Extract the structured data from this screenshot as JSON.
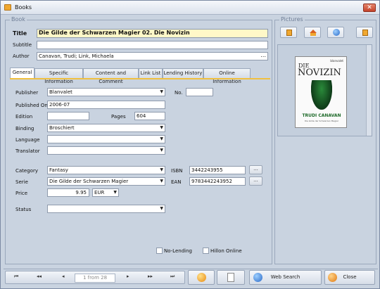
{
  "window": {
    "title": "Books"
  },
  "book": {
    "group_label": "Book",
    "title_label": "Title",
    "title_value": "Die Gilde der Schwarzen Magier 02. Die Novizin",
    "subtitle_label": "Subtitle",
    "subtitle_value": "",
    "author_label": "Author",
    "author_value": "Canavan, Trudi; Link, Michaela",
    "ellipsis": "..."
  },
  "tabs": [
    "General",
    "Specific Information",
    "Content and Comment",
    "Link List",
    "Lending History",
    "Online Information"
  ],
  "general": {
    "publisher_label": "Publisher",
    "publisher_value": "Blanvalet",
    "no_label": "No.",
    "no_value": "",
    "published_label": "Published On",
    "published_value": "2006-07",
    "edition_label": "Edition",
    "edition_value": "",
    "pages_label": "Pages",
    "pages_value": "604",
    "binding_label": "Binding",
    "binding_value": "Broschiert",
    "language_label": "Language",
    "language_value": "",
    "translator_label": "Translator",
    "translator_value": "",
    "category_label": "Category",
    "category_value": "Fantasy",
    "isbn_label": "ISBN",
    "isbn_value": "3442243955",
    "serie_label": "Serie",
    "serie_value": "Die Gilde der Schwarzen Magier",
    "ean_label": "EAN",
    "ean_value": "9783442243952",
    "price_label": "Price",
    "price_value": "9.95",
    "currency_value": "EUR",
    "status_label": "Status",
    "status_value": "",
    "no_lending_label": "No-Lending",
    "hillon_label": "Hillon Online",
    "dots": "..."
  },
  "pictures": {
    "group_label": "Pictures",
    "cover_publisher": "blanvalet",
    "cover_title": "NOVIZIN",
    "cover_title_small": "DIE",
    "cover_author": "TRUDI CANAVAN",
    "cover_subtitle": "Die Gilde der Schwarzen Magier"
  },
  "navigation": {
    "first": "⏮",
    "prev_page": "◂◂",
    "prev": "◂",
    "counter": "1 from 28",
    "next": "▸",
    "next_page": "▸▸",
    "last": "⏭"
  },
  "actions": {
    "web_search": "Web Search",
    "close": "Close"
  },
  "colors": {
    "accent": "#f0c040",
    "title_field": "#fff8c8",
    "window_bg": "#c9d3e0"
  }
}
